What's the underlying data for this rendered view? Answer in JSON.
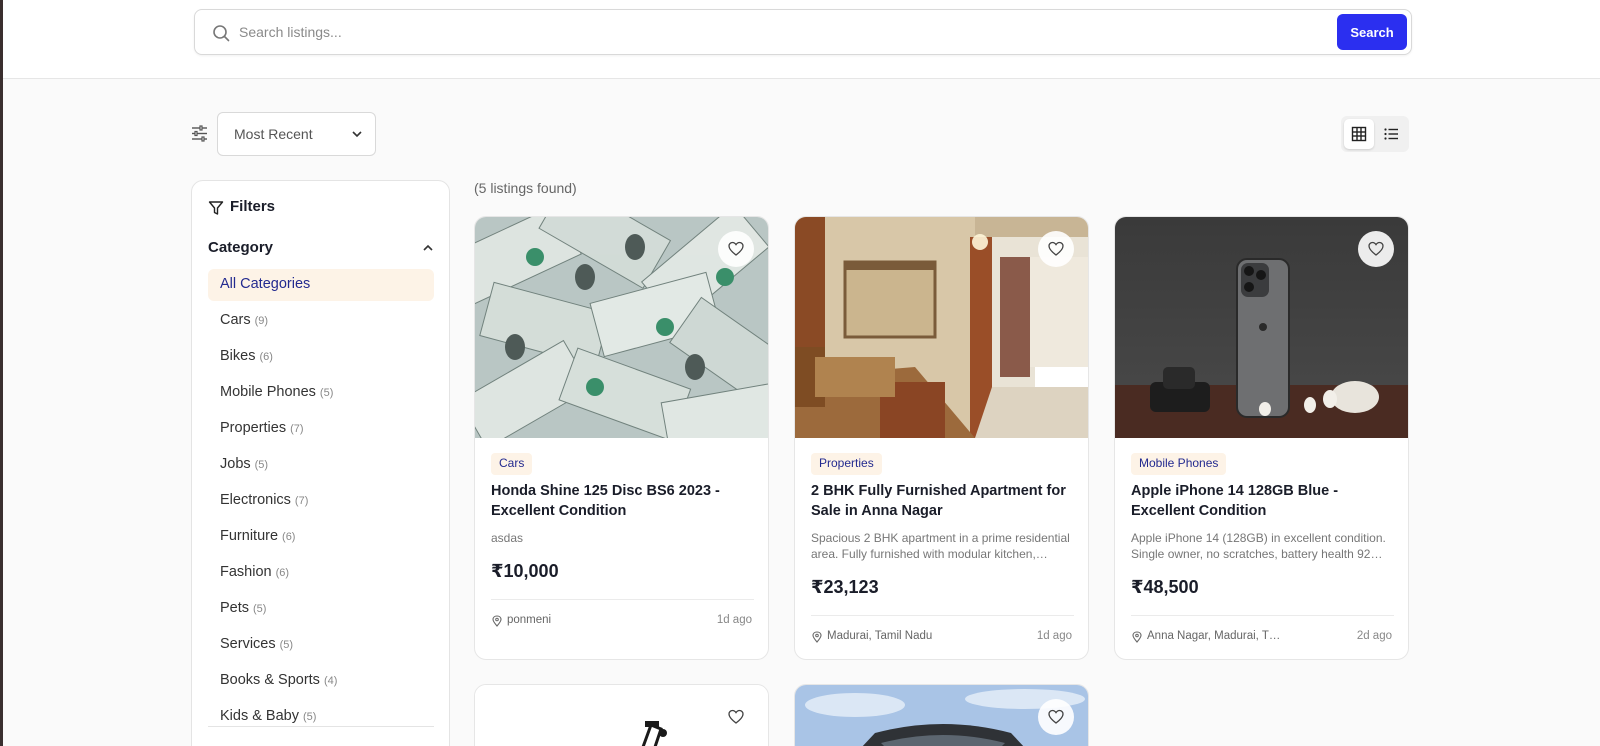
{
  "search": {
    "placeholder": "Search listings...",
    "button_label": "Search"
  },
  "toolbar": {
    "sort_value": "Most Recent",
    "view_modes": [
      "grid",
      "list"
    ],
    "active_view": "grid"
  },
  "filters": {
    "title": "Filters",
    "category_heading": "Category",
    "categories": [
      {
        "label": "All Categories",
        "count": ""
      },
      {
        "label": "Cars",
        "count": "(9)"
      },
      {
        "label": "Bikes",
        "count": "(6)"
      },
      {
        "label": "Mobile Phones",
        "count": "(5)"
      },
      {
        "label": "Properties",
        "count": "(7)"
      },
      {
        "label": "Jobs",
        "count": "(5)"
      },
      {
        "label": "Electronics",
        "count": "(7)"
      },
      {
        "label": "Furniture",
        "count": "(6)"
      },
      {
        "label": "Fashion",
        "count": "(6)"
      },
      {
        "label": "Pets",
        "count": "(5)"
      },
      {
        "label": "Services",
        "count": "(5)"
      },
      {
        "label": "Books & Sports",
        "count": "(4)"
      },
      {
        "label": "Kids & Baby",
        "count": "(5)"
      }
    ]
  },
  "results": {
    "count_text": "(5 listings found)"
  },
  "listings": [
    {
      "category": "Cars",
      "title": "Honda Shine 125 Disc BS6 2023 - Excellent Condition",
      "description": "asdas",
      "price": "₹10,000",
      "location": "ponmeni",
      "time": "1d ago"
    },
    {
      "category": "Properties",
      "title": "2 BHK Fully Furnished Apartment for Sale in Anna Nagar",
      "description": "Spacious 2 BHK apartment in a prime residential area. Fully furnished with modular kitchen,…",
      "price": "₹23,123",
      "location": "Madurai, Tamil Nadu",
      "time": "1d ago"
    },
    {
      "category": "Mobile Phones",
      "title": "Apple iPhone 14 128GB Blue - Excellent Condition",
      "description": "Apple iPhone 14 (128GB) in excellent condition. Single owner, no scratches, battery health 92…",
      "price": "₹48,500",
      "location": "Anna Nagar, Madurai, T…",
      "time": "2d ago"
    }
  ],
  "colors": {
    "accent": "#2b2ff0",
    "badge_bg": "#fdf3e7",
    "badge_text": "#232a8f"
  }
}
